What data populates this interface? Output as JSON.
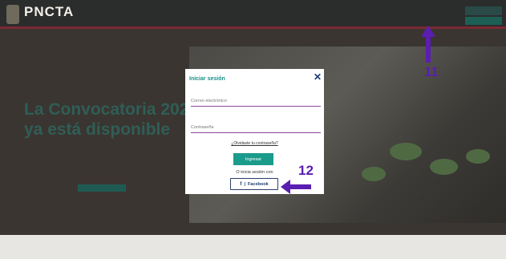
{
  "nav": {
    "logo": "PNCTA",
    "logo_subtitle": "",
    "links": [
      "",
      "",
      "",
      "",
      "",
      "",
      ""
    ],
    "right_link_1": "",
    "right_link_2": "",
    "button_a": "",
    "button_b": ""
  },
  "hero": {
    "title_line_1": "La Convocatoria 202",
    "title_line_2": "ya está disponible",
    "bullets": [
      "",
      "",
      "",
      ""
    ],
    "cta": ""
  },
  "modal": {
    "title": "Iniciar sesión",
    "email_placeholder": "Correo electrónico",
    "password_placeholder": "Contraseña",
    "forgot": "¿Olvidaste tu contraseña?",
    "login_button": "Ingresar",
    "alt_login": "O inicia sesión con",
    "facebook_icon_glyph": "f",
    "facebook_separator": "|",
    "facebook_button": "Facebook"
  },
  "annotations": {
    "number_11": "11",
    "number_12": "12",
    "color": "#5a1eb0"
  },
  "colors": {
    "accent": "#1a9b8b",
    "nav_stripe": "#7a2a32",
    "facebook": "#1b3b73"
  }
}
